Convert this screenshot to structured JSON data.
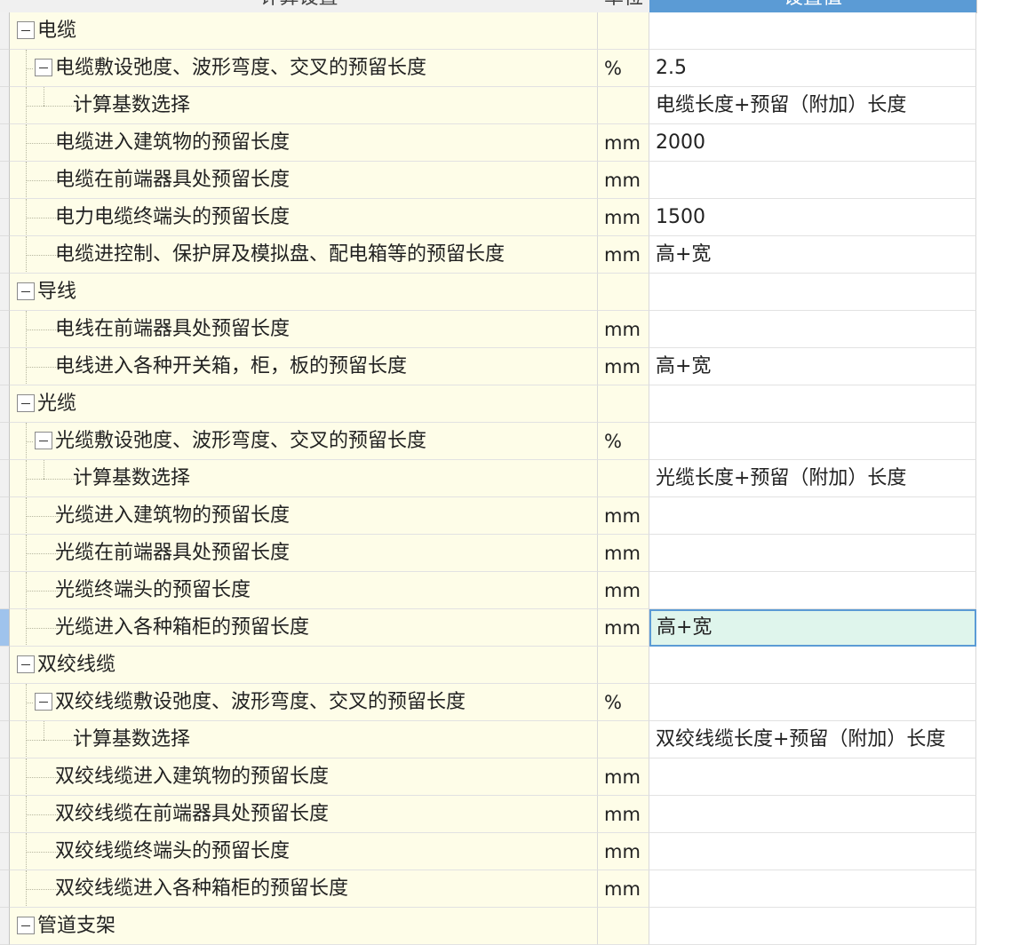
{
  "columns": {
    "name": "计算设置",
    "unit": "单位",
    "value": "设置值"
  },
  "rows": [
    {
      "label": "电缆",
      "unit": "",
      "value": "",
      "level": 0,
      "toggle": true
    },
    {
      "label": "电缆敷设弛度、波形弯度、交叉的预留长度",
      "unit": "%",
      "value": "2.5",
      "level": 1,
      "toggle": true
    },
    {
      "label": "计算基数选择",
      "unit": "",
      "value": "电缆长度+预留（附加）长度",
      "level": 2,
      "toggle": false
    },
    {
      "label": "电缆进入建筑物的预留长度",
      "unit": "mm",
      "value": "2000",
      "level": 1,
      "toggle": false
    },
    {
      "label": "电缆在前端器具处预留长度",
      "unit": "mm",
      "value": "",
      "level": 1,
      "toggle": false
    },
    {
      "label": "电力电缆终端头的预留长度",
      "unit": "mm",
      "value": "1500",
      "level": 1,
      "toggle": false
    },
    {
      "label": "电缆进控制、保护屏及模拟盘、配电箱等的预留长度",
      "unit": "mm",
      "value": "高+宽",
      "level": 1,
      "toggle": false
    },
    {
      "label": "导线",
      "unit": "",
      "value": "",
      "level": 0,
      "toggle": true
    },
    {
      "label": "电线在前端器具处预留长度",
      "unit": "mm",
      "value": "",
      "level": 1,
      "toggle": false
    },
    {
      "label": "电线进入各种开关箱，柜，板的预留长度",
      "unit": "mm",
      "value": "高+宽",
      "level": 1,
      "toggle": false
    },
    {
      "label": "光缆",
      "unit": "",
      "value": "",
      "level": 0,
      "toggle": true
    },
    {
      "label": "光缆敷设弛度、波形弯度、交叉的预留长度",
      "unit": "%",
      "value": "",
      "level": 1,
      "toggle": true
    },
    {
      "label": "计算基数选择",
      "unit": "",
      "value": "光缆长度+预留（附加）长度",
      "level": 2,
      "toggle": false
    },
    {
      "label": "光缆进入建筑物的预留长度",
      "unit": "mm",
      "value": "",
      "level": 1,
      "toggle": false
    },
    {
      "label": "光缆在前端器具处预留长度",
      "unit": "mm",
      "value": "",
      "level": 1,
      "toggle": false
    },
    {
      "label": "光缆终端头的预留长度",
      "unit": "mm",
      "value": "",
      "level": 1,
      "toggle": false
    },
    {
      "label": "光缆进入各种箱柜的预留长度",
      "unit": "mm",
      "value": "高+宽",
      "level": 1,
      "toggle": false,
      "selected": true
    },
    {
      "label": "双绞线缆",
      "unit": "",
      "value": "",
      "level": 0,
      "toggle": true
    },
    {
      "label": "双绞线缆敷设弛度、波形弯度、交叉的预留长度",
      "unit": "%",
      "value": "",
      "level": 1,
      "toggle": true
    },
    {
      "label": "计算基数选择",
      "unit": "",
      "value": "双绞线缆长度+预留（附加）长度",
      "level": 2,
      "toggle": false
    },
    {
      "label": "双绞线缆进入建筑物的预留长度",
      "unit": "mm",
      "value": "",
      "level": 1,
      "toggle": false
    },
    {
      "label": "双绞线缆在前端器具处预留长度",
      "unit": "mm",
      "value": "",
      "level": 1,
      "toggle": false
    },
    {
      "label": "双绞线缆终端头的预留长度",
      "unit": "mm",
      "value": "",
      "level": 1,
      "toggle": false
    },
    {
      "label": "双绞线缆进入各种箱柜的预留长度",
      "unit": "mm",
      "value": "",
      "level": 1,
      "toggle": false
    },
    {
      "label": "管道支架",
      "unit": "",
      "value": "",
      "level": 0,
      "toggle": true
    }
  ],
  "icons": {
    "collapse": "collapse-minus-icon"
  },
  "colors": {
    "name_bg": "#fefde8",
    "selected_cell": "#dff5ec",
    "header_active": "#5b9bd5"
  }
}
